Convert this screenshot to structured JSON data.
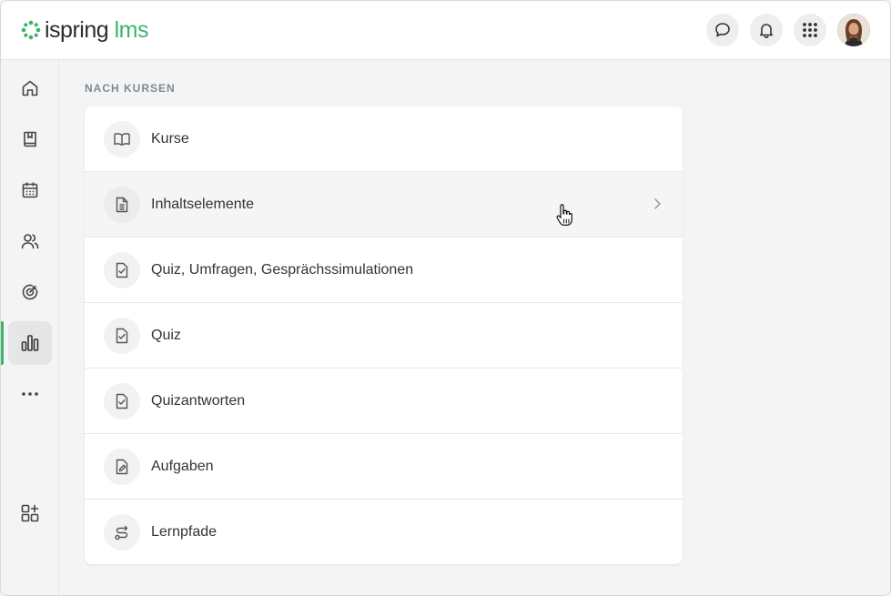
{
  "header": {
    "logo_primary": "ispring",
    "logo_secondary": "lms",
    "brand_color": "#3bb46a",
    "buttons": [
      {
        "icon": "chat-icon"
      },
      {
        "icon": "bell-icon"
      },
      {
        "icon": "apps-grid-icon"
      }
    ],
    "avatar_icon": "user-avatar"
  },
  "sidebar": {
    "items": [
      {
        "icon": "home-icon",
        "active": false
      },
      {
        "icon": "book-icon",
        "active": false
      },
      {
        "icon": "calendar-icon",
        "active": false
      },
      {
        "icon": "users-icon",
        "active": false
      },
      {
        "icon": "target-icon",
        "active": false
      },
      {
        "icon": "reports-chart-icon",
        "active": true
      },
      {
        "icon": "more-icon",
        "active": false
      }
    ],
    "bottom_item": {
      "icon": "add-widget-icon"
    }
  },
  "main": {
    "section_title": "NACH KURSEN",
    "items": [
      {
        "label": "Kurse",
        "icon": "open-book-icon"
      },
      {
        "label": "Inhaltselemente",
        "icon": "document-icon"
      },
      {
        "label": "Quiz, Umfragen, Gesprächssimulationen",
        "icon": "checklist-icon"
      },
      {
        "label": "Quiz",
        "icon": "checklist-icon"
      },
      {
        "label": "Quizantworten",
        "icon": "checklist-icon"
      },
      {
        "label": "Aufgaben",
        "icon": "edit-document-icon"
      },
      {
        "label": "Lernpfade",
        "icon": "route-icon"
      }
    ],
    "hovered_index": 1
  }
}
